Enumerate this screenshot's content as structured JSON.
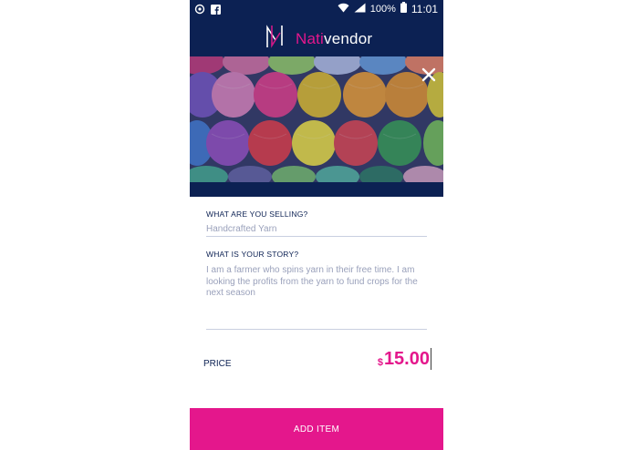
{
  "status_bar": {
    "battery_percent": "100%",
    "time": "11:01",
    "icons": [
      "sync-icon",
      "facebook-icon",
      "wifi-icon",
      "signal-icon",
      "battery-icon"
    ]
  },
  "app": {
    "logo_letter": "N",
    "brand_part1": "Nati",
    "brand_part2": "vendor",
    "accent_color": "#e4178c",
    "brand_color": "#0c2153"
  },
  "hero": {
    "image_subject": "colorful yarn balls",
    "close_icon": "close-icon"
  },
  "form": {
    "selling_label": "WHAT ARE YOU SELLING?",
    "selling_value": "Handcrafted Yarn",
    "story_label": "WHAT IS YOUR STORY?",
    "story_value": "I am a farmer who spins yarn in their free time. I am looking the profits from the yarn to fund crops for the next season",
    "price_label": "PRICE",
    "price_currency": "$",
    "price_value": "15.00"
  },
  "actions": {
    "add_item_label": "ADD ITEM"
  }
}
